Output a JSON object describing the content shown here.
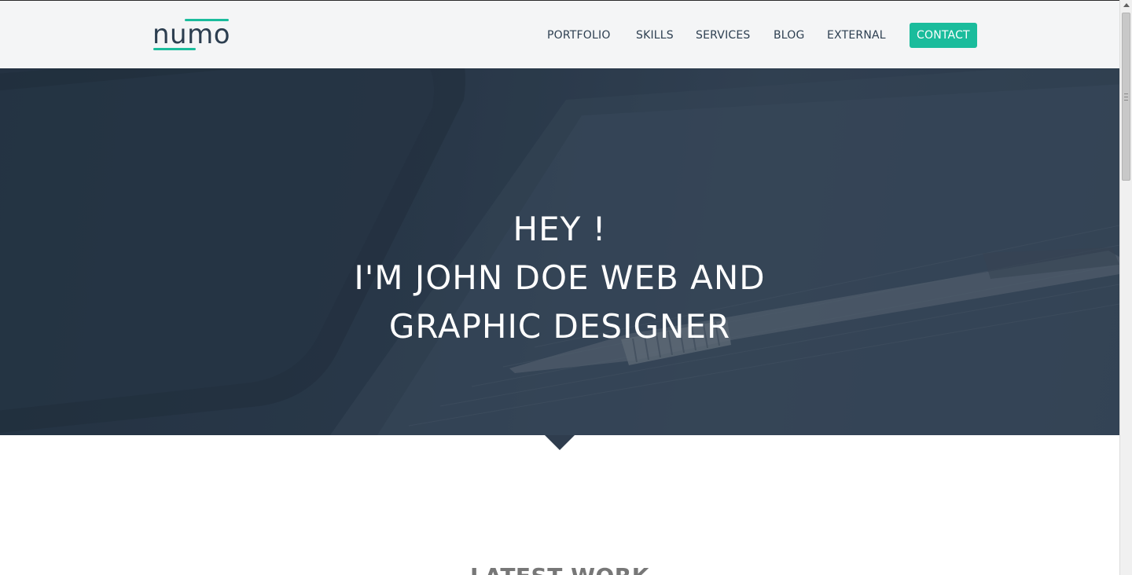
{
  "header": {
    "logo_text": "numo",
    "nav": [
      {
        "label": "PORTFOLIO"
      },
      {
        "label": "SKILLS"
      },
      {
        "label": "SERVICES"
      },
      {
        "label": "BLOG"
      },
      {
        "label": "EXTERNAL"
      },
      {
        "label": "CONTACT"
      }
    ]
  },
  "hero": {
    "line1": "HEY !",
    "line2": "I'M JOHN DOE WEB AND",
    "line3": "GRAPHIC DESIGNER"
  },
  "section": {
    "title": "LATEST WORK"
  },
  "colors": {
    "accent": "#1abc9c",
    "dark": "#2c3e50",
    "hero_overlay": "#2f3d4e",
    "section_title": "#777777"
  },
  "icons": [
    "menu-icon",
    "scroll-up-icon"
  ]
}
